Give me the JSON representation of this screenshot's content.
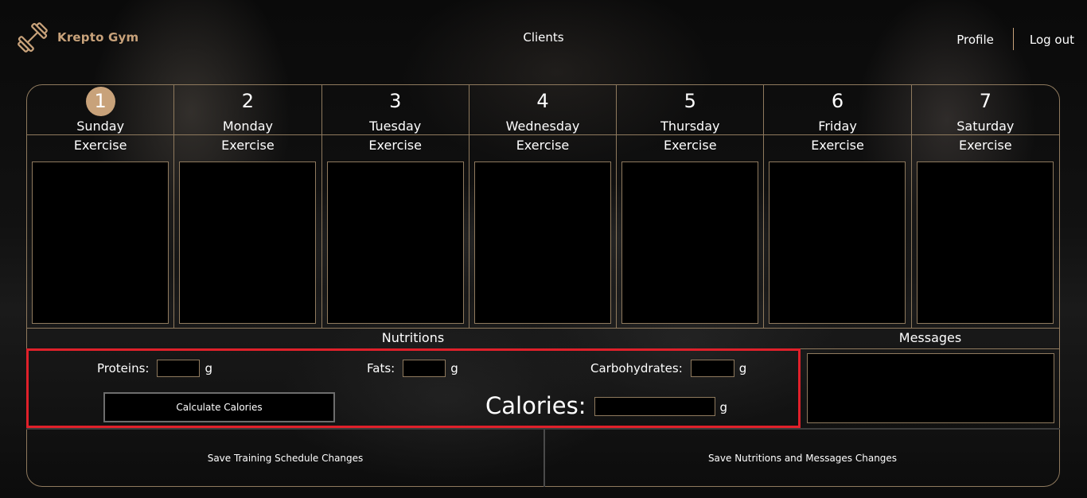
{
  "header": {
    "brand_name": "Krepto Gym",
    "nav_clients": "Clients",
    "nav_profile": "Profile",
    "nav_logout": "Log out"
  },
  "schedule": {
    "exercise_label": "Exercise",
    "days": [
      {
        "number": "1",
        "name": "Sunday",
        "active": true
      },
      {
        "number": "2",
        "name": "Monday"
      },
      {
        "number": "3",
        "name": "Tuesday"
      },
      {
        "number": "4",
        "name": "Wednesday"
      },
      {
        "number": "5",
        "name": "Thursday"
      },
      {
        "number": "6",
        "name": "Friday"
      },
      {
        "number": "7",
        "name": "Saturday"
      }
    ]
  },
  "nutrition": {
    "section_label": "Nutritions",
    "proteins_label": "Proteins:",
    "fats_label": "Fats:",
    "carbs_label": "Carbohydrates:",
    "unit": "g",
    "calculate_button": "Calculate Calories",
    "calories_label": "Calories:"
  },
  "messages": {
    "section_label": "Messages"
  },
  "actions": {
    "save_training": "Save Training Schedule Changes",
    "save_nutrition": "Save Nutritions and Messages Changes"
  },
  "colors": {
    "accent": "#c8a27a",
    "border": "#8f7a5e",
    "highlight": "#e0202a"
  }
}
